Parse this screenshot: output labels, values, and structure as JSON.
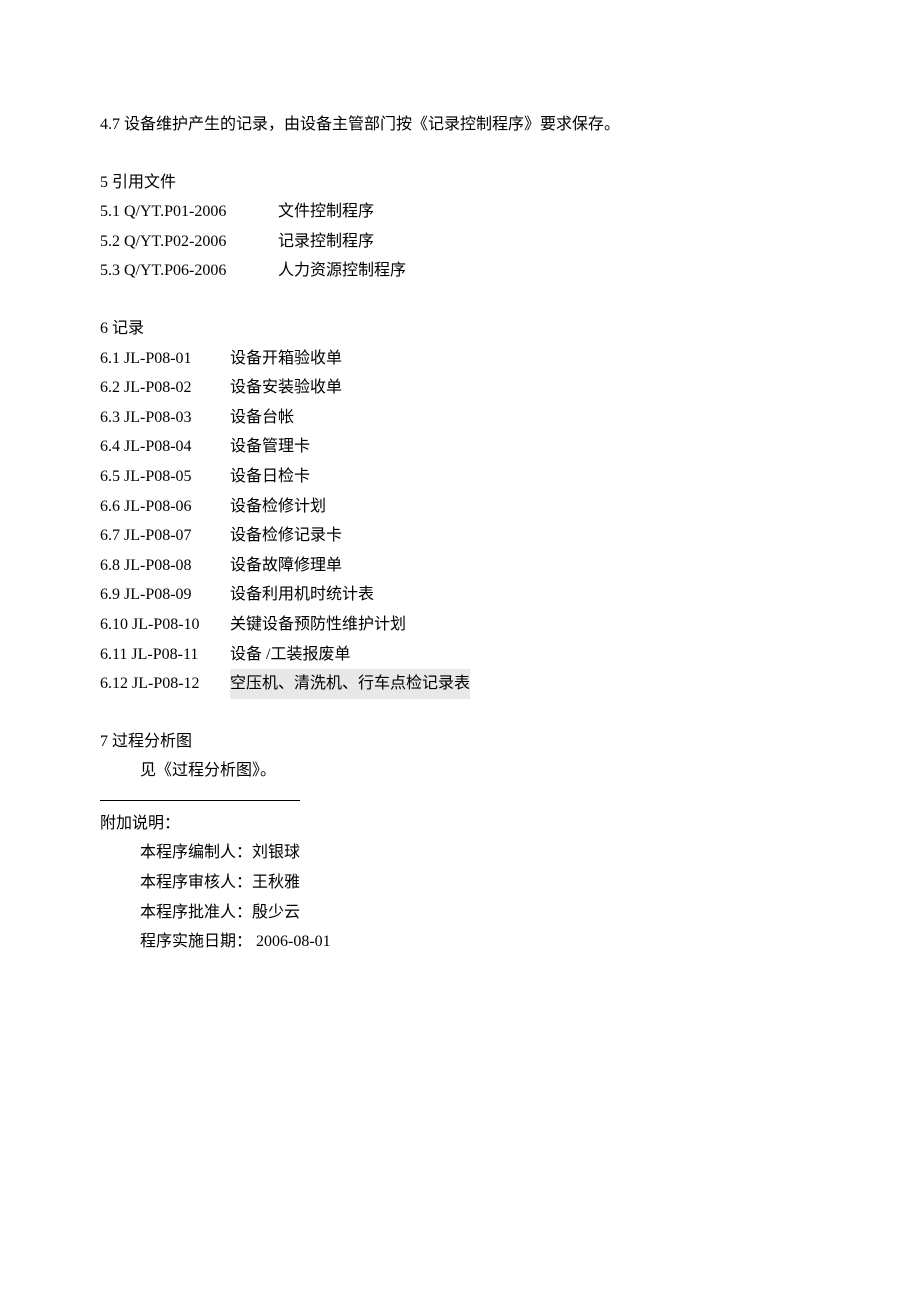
{
  "section_4_7": "4.7 设备维护产生的记录，由设备主管部门按《记录控制程序》要求保存。",
  "section_5": {
    "title": "5 引用文件",
    "items": [
      {
        "code": "5.1 Q/YT.P01-2006",
        "name": "文件控制程序"
      },
      {
        "code": "5.2 Q/YT.P02-2006",
        "name": "记录控制程序"
      },
      {
        "code": "5.3 Q/YT.P06-2006",
        "name": "人力资源控制程序"
      }
    ]
  },
  "section_6": {
    "title": "6 记录",
    "items": [
      {
        "code": "6.1 JL-P08-01",
        "name": "设备开箱验收单",
        "hl": false
      },
      {
        "code": "6.2 JL-P08-02",
        "name": "设备安装验收单",
        "hl": false
      },
      {
        "code": "6.3 JL-P08-03",
        "name": "设备台帐",
        "hl": false
      },
      {
        "code": "6.4 JL-P08-04",
        "name": "设备管理卡",
        "hl": false
      },
      {
        "code": "6.5 JL-P08-05",
        "name": "设备日检卡",
        "hl": false
      },
      {
        "code": "6.6 JL-P08-06",
        "name": "设备检修计划",
        "hl": false
      },
      {
        "code": "6.7 JL-P08-07",
        "name": "设备检修记录卡",
        "hl": false
      },
      {
        "code": "6.8 JL-P08-08",
        "name": "设备故障修理单",
        "hl": false
      },
      {
        "code": "6.9 JL-P08-09",
        "name": "设备利用机时统计表",
        "hl": false
      },
      {
        "code": "6.10 JL-P08-10",
        "name": "关键设备预防性维护计划",
        "hl": false
      },
      {
        "code": "6.11 JL-P08-11",
        "name": "设备 /工装报废单",
        "hl": false
      },
      {
        "code": "6.12 JL-P08-12",
        "name": "空压机、清洗机、行车点检记录表",
        "hl": true
      }
    ]
  },
  "section_7": {
    "title": "7 过程分析图",
    "body": "见《过程分析图》。"
  },
  "appendix": {
    "title": "附加说明：",
    "lines": [
      "本程序编制人：刘银球",
      "本程序审核人：王秋雅",
      "本程序批准人：殷少云",
      "程序实施日期： 2006-08-01"
    ]
  }
}
